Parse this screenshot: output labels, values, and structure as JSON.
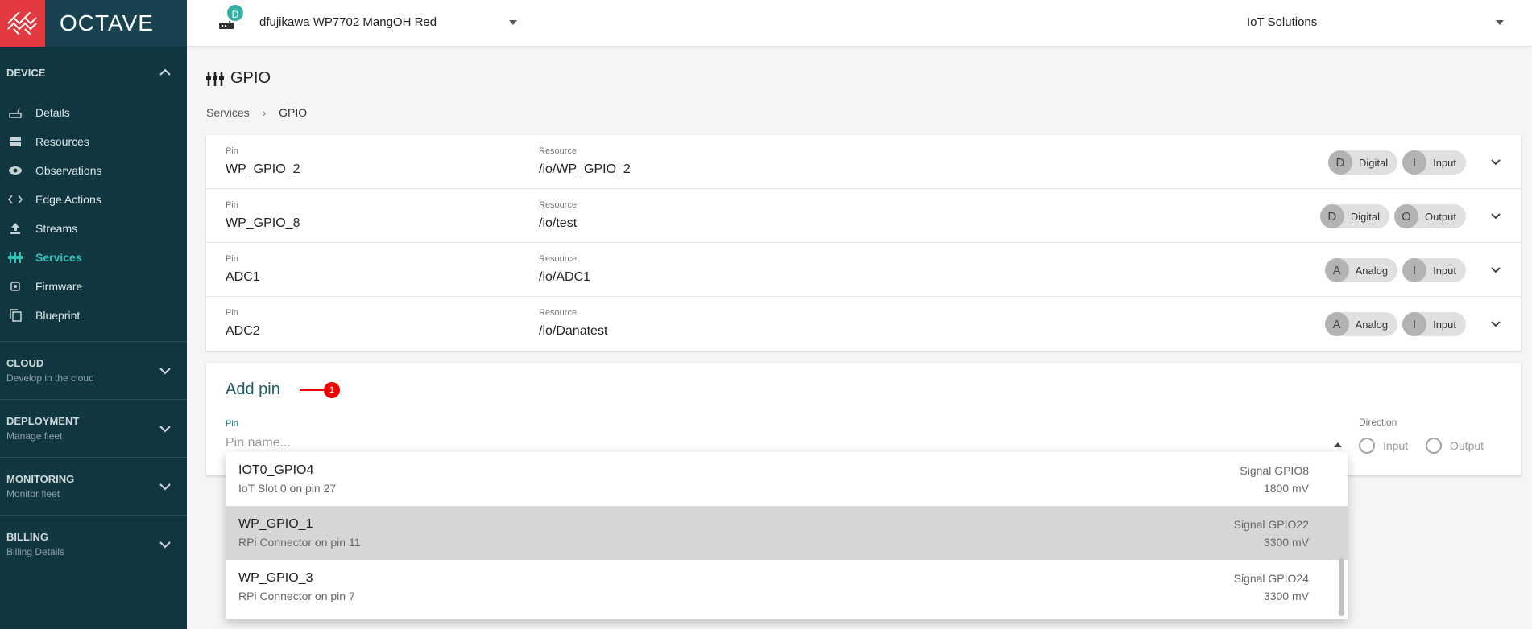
{
  "app": {
    "logo_text": "OCTAVE"
  },
  "sidebar": {
    "device_section": "DEVICE",
    "items": [
      {
        "label": "Details"
      },
      {
        "label": "Resources"
      },
      {
        "label": "Observations"
      },
      {
        "label": "Edge Actions"
      },
      {
        "label": "Streams"
      },
      {
        "label": "Services",
        "active": true
      },
      {
        "label": "Firmware"
      },
      {
        "label": "Blueprint"
      }
    ],
    "groups": [
      {
        "title": "CLOUD",
        "subtitle": "Develop in the cloud"
      },
      {
        "title": "DEPLOYMENT",
        "subtitle": "Manage fleet"
      },
      {
        "title": "MONITORING",
        "subtitle": "Monitor fleet"
      },
      {
        "title": "BILLING",
        "subtitle": "Billing Details"
      }
    ]
  },
  "topbar": {
    "device_badge": "D",
    "device_name": "dfujikawa WP7702 MangOH Red",
    "company": "IoT Solutions"
  },
  "page": {
    "title": "GPIO",
    "breadcrumb": {
      "parent": "Services",
      "current": "GPIO"
    }
  },
  "pins": {
    "pin_label": "Pin",
    "resource_label": "Resource",
    "rows": [
      {
        "pin": "WP_GPIO_2",
        "resource": "/io/WP_GPIO_2",
        "type_av": "D",
        "type": "Digital",
        "dir_av": "I",
        "dir": "Input"
      },
      {
        "pin": "WP_GPIO_8",
        "resource": "/io/test",
        "type_av": "D",
        "type": "Digital",
        "dir_av": "O",
        "dir": "Output"
      },
      {
        "pin": "ADC1",
        "resource": "/io/ADC1",
        "type_av": "A",
        "type": "Analog",
        "dir_av": "I",
        "dir": "Input"
      },
      {
        "pin": "ADC2",
        "resource": "/io/Danatest",
        "type_av": "A",
        "type": "Analog",
        "dir_av": "I",
        "dir": "Input"
      }
    ]
  },
  "add_pin": {
    "title": "Add pin",
    "marker": "1",
    "pin_label": "Pin",
    "pin_placeholder": "Pin name...",
    "direction_label": "Direction",
    "direction_options": [
      "Input",
      "Output"
    ]
  },
  "dropdown": {
    "options": [
      {
        "name": "IOT0_GPIO4",
        "desc": "IoT Slot 0 on pin 27",
        "signal": "Signal GPIO8",
        "mv": "1800 mV",
        "highlighted": false
      },
      {
        "name": "WP_GPIO_1",
        "desc": "RPi Connector on pin 11",
        "signal": "Signal GPIO22",
        "mv": "3300 mV",
        "highlighted": true
      },
      {
        "name": "WP_GPIO_3",
        "desc": "RPi Connector on pin 7",
        "signal": "Signal GPIO24",
        "mv": "3300 mV",
        "highlighted": false
      }
    ]
  },
  "colors": {
    "sidebar_bg": "#103640",
    "accent": "#2fc3b8",
    "logo_red": "#e23a3e",
    "marker_red": "#e00000"
  }
}
